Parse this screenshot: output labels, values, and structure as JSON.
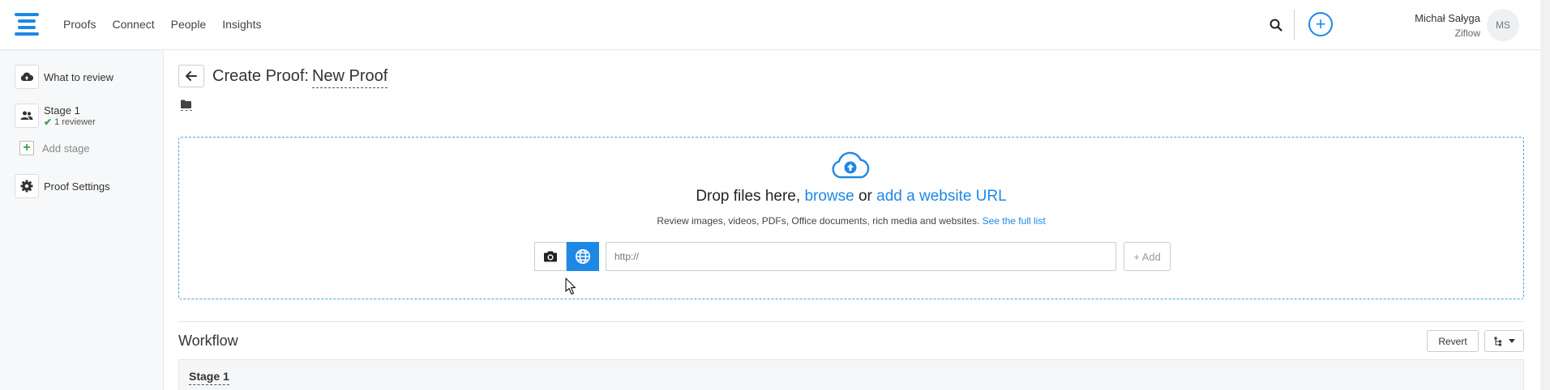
{
  "nav": {
    "items": [
      "Proofs",
      "Connect",
      "People",
      "Insights"
    ]
  },
  "user": {
    "name": "Michał Sałyga",
    "org": "Ziflow",
    "initials": "MS"
  },
  "header": {
    "add_label": "+"
  },
  "sidebar": {
    "what_to_review": "What to review",
    "stage": {
      "name": "Stage 1",
      "reviewers": "1 reviewer"
    },
    "add_stage": "Add stage",
    "proof_settings": "Proof Settings"
  },
  "page": {
    "title_prefix": "Create Proof:",
    "proof_name": "New Proof"
  },
  "dropzone": {
    "title_start": "Drop files here, ",
    "browse": "browse",
    "or": " or ",
    "website_url": "add a website URL",
    "subtitle": "Review images, videos, PDFs, Office documents, rich media and websites. ",
    "full_list": "See the full list",
    "url_placeholder": "http://",
    "add_label": "+ Add"
  },
  "workflow": {
    "title": "Workflow",
    "revert": "Revert",
    "stage_name": "Stage 1"
  },
  "colors": {
    "accent": "#1e88e5",
    "success": "#43a047"
  }
}
